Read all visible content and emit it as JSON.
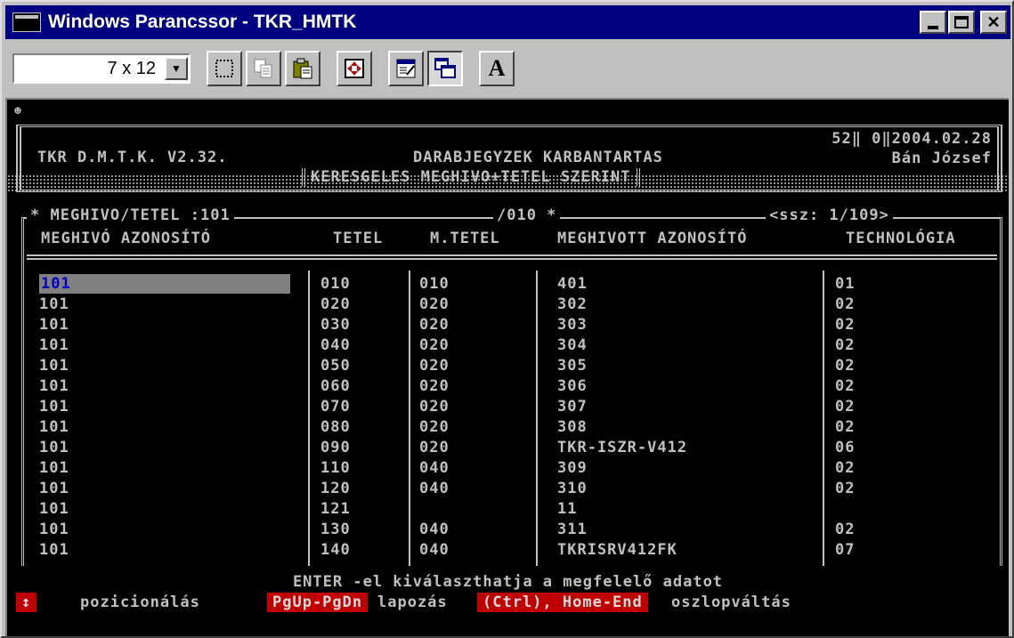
{
  "window": {
    "title": "Windows Parancssor - TKR_HMTK"
  },
  "toolbar": {
    "font_size": "7 x 12",
    "font_button_label": "A"
  },
  "console": {
    "smiley": "☻",
    "header": {
      "left": "TKR D.M.T.K. V2.32.",
      "center": "DARABJEGYZEK KARBANTARTAS",
      "subtitle": "KERESGELES MEGHIVO+TETEL SZERINT",
      "right_line1": "52‖ 0‖2004.02.28",
      "right_line2": "Bán József"
    },
    "list_info": {
      "left": "* MEGHIVO/TETEL :101",
      "middle": "/010 *",
      "right": "<ssz: 1/109>"
    },
    "columns": {
      "id": "MEGHIVÓ AZONOSÍTÓ",
      "tetel": "TETEL",
      "mtetel": "M.TETEL",
      "called_id": "MEGHIVOTT AZONOSÍTÓ",
      "tech": "TECHNOLÓGIA"
    },
    "rows": [
      {
        "id": "101",
        "tetel": "010",
        "mtetel": "010",
        "called_id": "401",
        "tech": "01"
      },
      {
        "id": "101",
        "tetel": "020",
        "mtetel": "020",
        "called_id": "302",
        "tech": "02"
      },
      {
        "id": "101",
        "tetel": "030",
        "mtetel": "020",
        "called_id": "303",
        "tech": "02"
      },
      {
        "id": "101",
        "tetel": "040",
        "mtetel": "020",
        "called_id": "304",
        "tech": "02"
      },
      {
        "id": "101",
        "tetel": "050",
        "mtetel": "020",
        "called_id": "305",
        "tech": "02"
      },
      {
        "id": "101",
        "tetel": "060",
        "mtetel": "020",
        "called_id": "306",
        "tech": "02"
      },
      {
        "id": "101",
        "tetel": "070",
        "mtetel": "020",
        "called_id": "307",
        "tech": "02"
      },
      {
        "id": "101",
        "tetel": "080",
        "mtetel": "020",
        "called_id": "308",
        "tech": "02"
      },
      {
        "id": "101",
        "tetel": "090",
        "mtetel": "020",
        "called_id": "TKR-ISZR-V412",
        "tech": "06"
      },
      {
        "id": "101",
        "tetel": "110",
        "mtetel": "040",
        "called_id": "309",
        "tech": "02"
      },
      {
        "id": "101",
        "tetel": "120",
        "mtetel": "040",
        "called_id": "310",
        "tech": "02"
      },
      {
        "id": "101",
        "tetel": "121",
        "mtetel": "",
        "called_id": "11",
        "tech": ""
      },
      {
        "id": "101",
        "tetel": "130",
        "mtetel": "040",
        "called_id": "311",
        "tech": "02"
      },
      {
        "id": "101",
        "tetel": "140",
        "mtetel": "040",
        "called_id": "TKRISRV412FK",
        "tech": "07"
      }
    ],
    "footer": {
      "message": "ENTER -el kiválaszthatja a megfelelő adatot",
      "key1": "↕",
      "text1": "pozicionálás",
      "key2": "PgUp-PgDn",
      "text2": "lapozás",
      "key3": "(Ctrl), Home-End",
      "text3": "oszlopváltás"
    }
  }
}
